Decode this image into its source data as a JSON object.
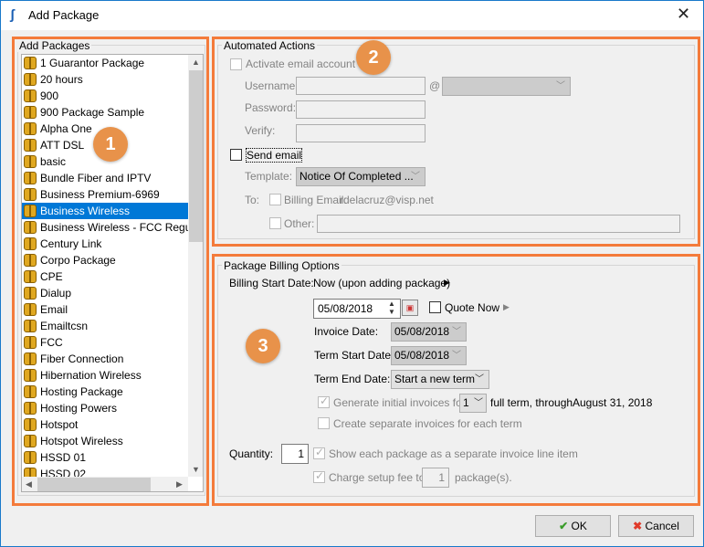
{
  "window": {
    "title": "Add Package"
  },
  "add_packages": {
    "label": "Add Packages",
    "selected": "Business Wireless",
    "items": [
      "1 Guarantor Package",
      "20 hours",
      "900",
      "900 Package Sample",
      "Alpha One",
      "ATT DSL",
      "basic",
      "Bundle Fiber and IPTV",
      "Business Premium-6969",
      "Business Wireless",
      "Business Wireless - FCC Regulato",
      "Century Link",
      "Corpo Package",
      "CPE",
      "Dialup",
      "Email",
      "Emailtcsn",
      "FCC",
      "Fiber Connection",
      "Hibernation Wireless",
      "Hosting Package",
      "Hosting Powers",
      "Hotspot",
      "Hotspot Wireless",
      "HSSD 01",
      "HSSD 02"
    ]
  },
  "badges": [
    "1",
    "2",
    "3"
  ],
  "automated_actions": {
    "label": "Automated Actions",
    "activate_email": "Activate email account",
    "username_label": "Username:",
    "at": "@",
    "password_label": "Password:",
    "verify_label": "Verify:",
    "send_email": "Send email",
    "template_label": "Template:",
    "template_value": "Notice Of Completed ...",
    "to_label": "To:",
    "billing_email_label": "Billing Email:",
    "billing_email_value": "rdelacruz@visp.net",
    "other_label": "Other:"
  },
  "billing": {
    "label": "Package Billing Options",
    "start_label": "Billing Start Date:",
    "start_value": "Now (upon adding package)",
    "date_value": "05/08/2018",
    "quote_now": "Quote Now",
    "invoice_date_label": "Invoice Date:",
    "invoice_date": "05/08/2018",
    "term_start_label": "Term Start Date:",
    "term_start": "05/08/2018",
    "term_end_label": "Term End Date:",
    "term_end": "Start a new term",
    "generate_label": "Generate initial invoices for",
    "generate_count": "1",
    "through_label": "full term, through",
    "through_date": "August 31, 2018",
    "separate_label": "Create separate invoices for each term",
    "quantity_label": "Quantity:",
    "quantity": "1",
    "show_each_label": "Show each package as a separate invoice line item",
    "setup_fee_label": "Charge setup fee to",
    "setup_fee_count": "1",
    "setup_fee_suffix": "package(s)."
  },
  "buttons": {
    "ok": "OK",
    "cancel": "Cancel"
  },
  "colors": {
    "highlight": "#f47b3b",
    "selection": "#0078d7",
    "badge": "#e8924a"
  }
}
